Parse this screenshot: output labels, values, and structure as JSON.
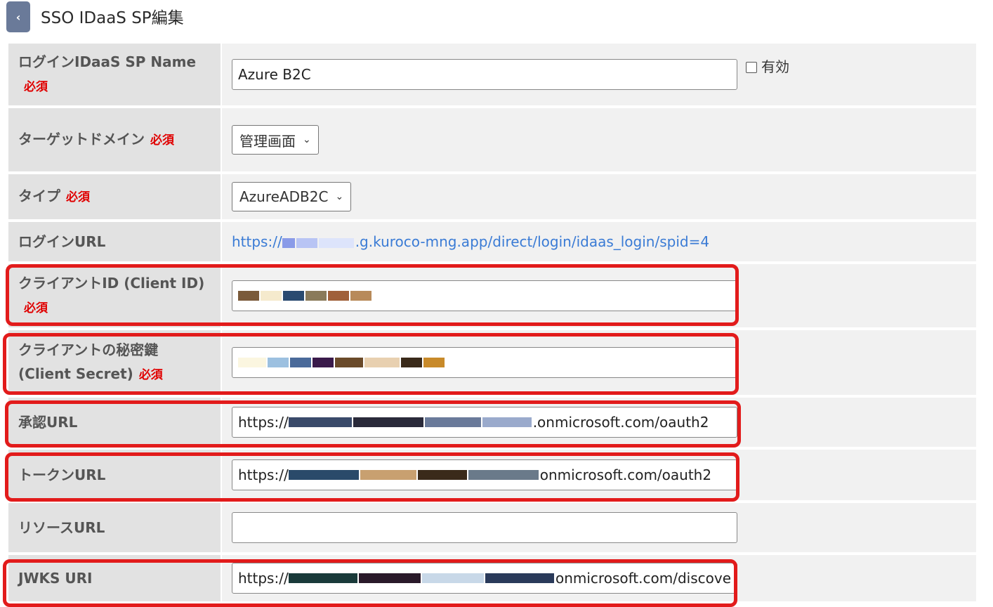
{
  "header": {
    "back_label": "‹",
    "title": "SSO IDaaS SP編集"
  },
  "required_label": "必須",
  "fields": {
    "name": {
      "label": "ログインIDaaS SP Name",
      "value": "Azure B2C",
      "enabled_label": "有効"
    },
    "target_domain": {
      "label": "ターゲットドメイン",
      "selected": "管理画面"
    },
    "type": {
      "label": "タイプ",
      "selected": "AzureADB2C"
    },
    "login_url": {
      "label": "ログインURL",
      "prefix": "https://",
      "suffix": ".g.kuroco-mng.app/direct/login/idaas_login/spid=4"
    },
    "client_id": {
      "label": "クライアントID (Client ID)"
    },
    "client_secret": {
      "label": "クライアントの秘密鍵 (Client Secret)"
    },
    "auth_url": {
      "label": "承認URL",
      "prefix": "https://",
      "suffix": ".onmicrosoft.com/oauth2"
    },
    "token_url": {
      "label": "トークンURL",
      "prefix": "https://",
      "suffix": "onmicrosoft.com/oauth2"
    },
    "resource_url": {
      "label": "リソースURL",
      "value": ""
    },
    "jwks_uri": {
      "label": "JWKS URI",
      "prefix": "https://",
      "suffix": "onmicrosoft.com/discove"
    }
  },
  "colors": {
    "highlight": "#e21b1b",
    "link": "#3a7bd5",
    "required": "#e00000",
    "back_button": "#6a7a99"
  }
}
